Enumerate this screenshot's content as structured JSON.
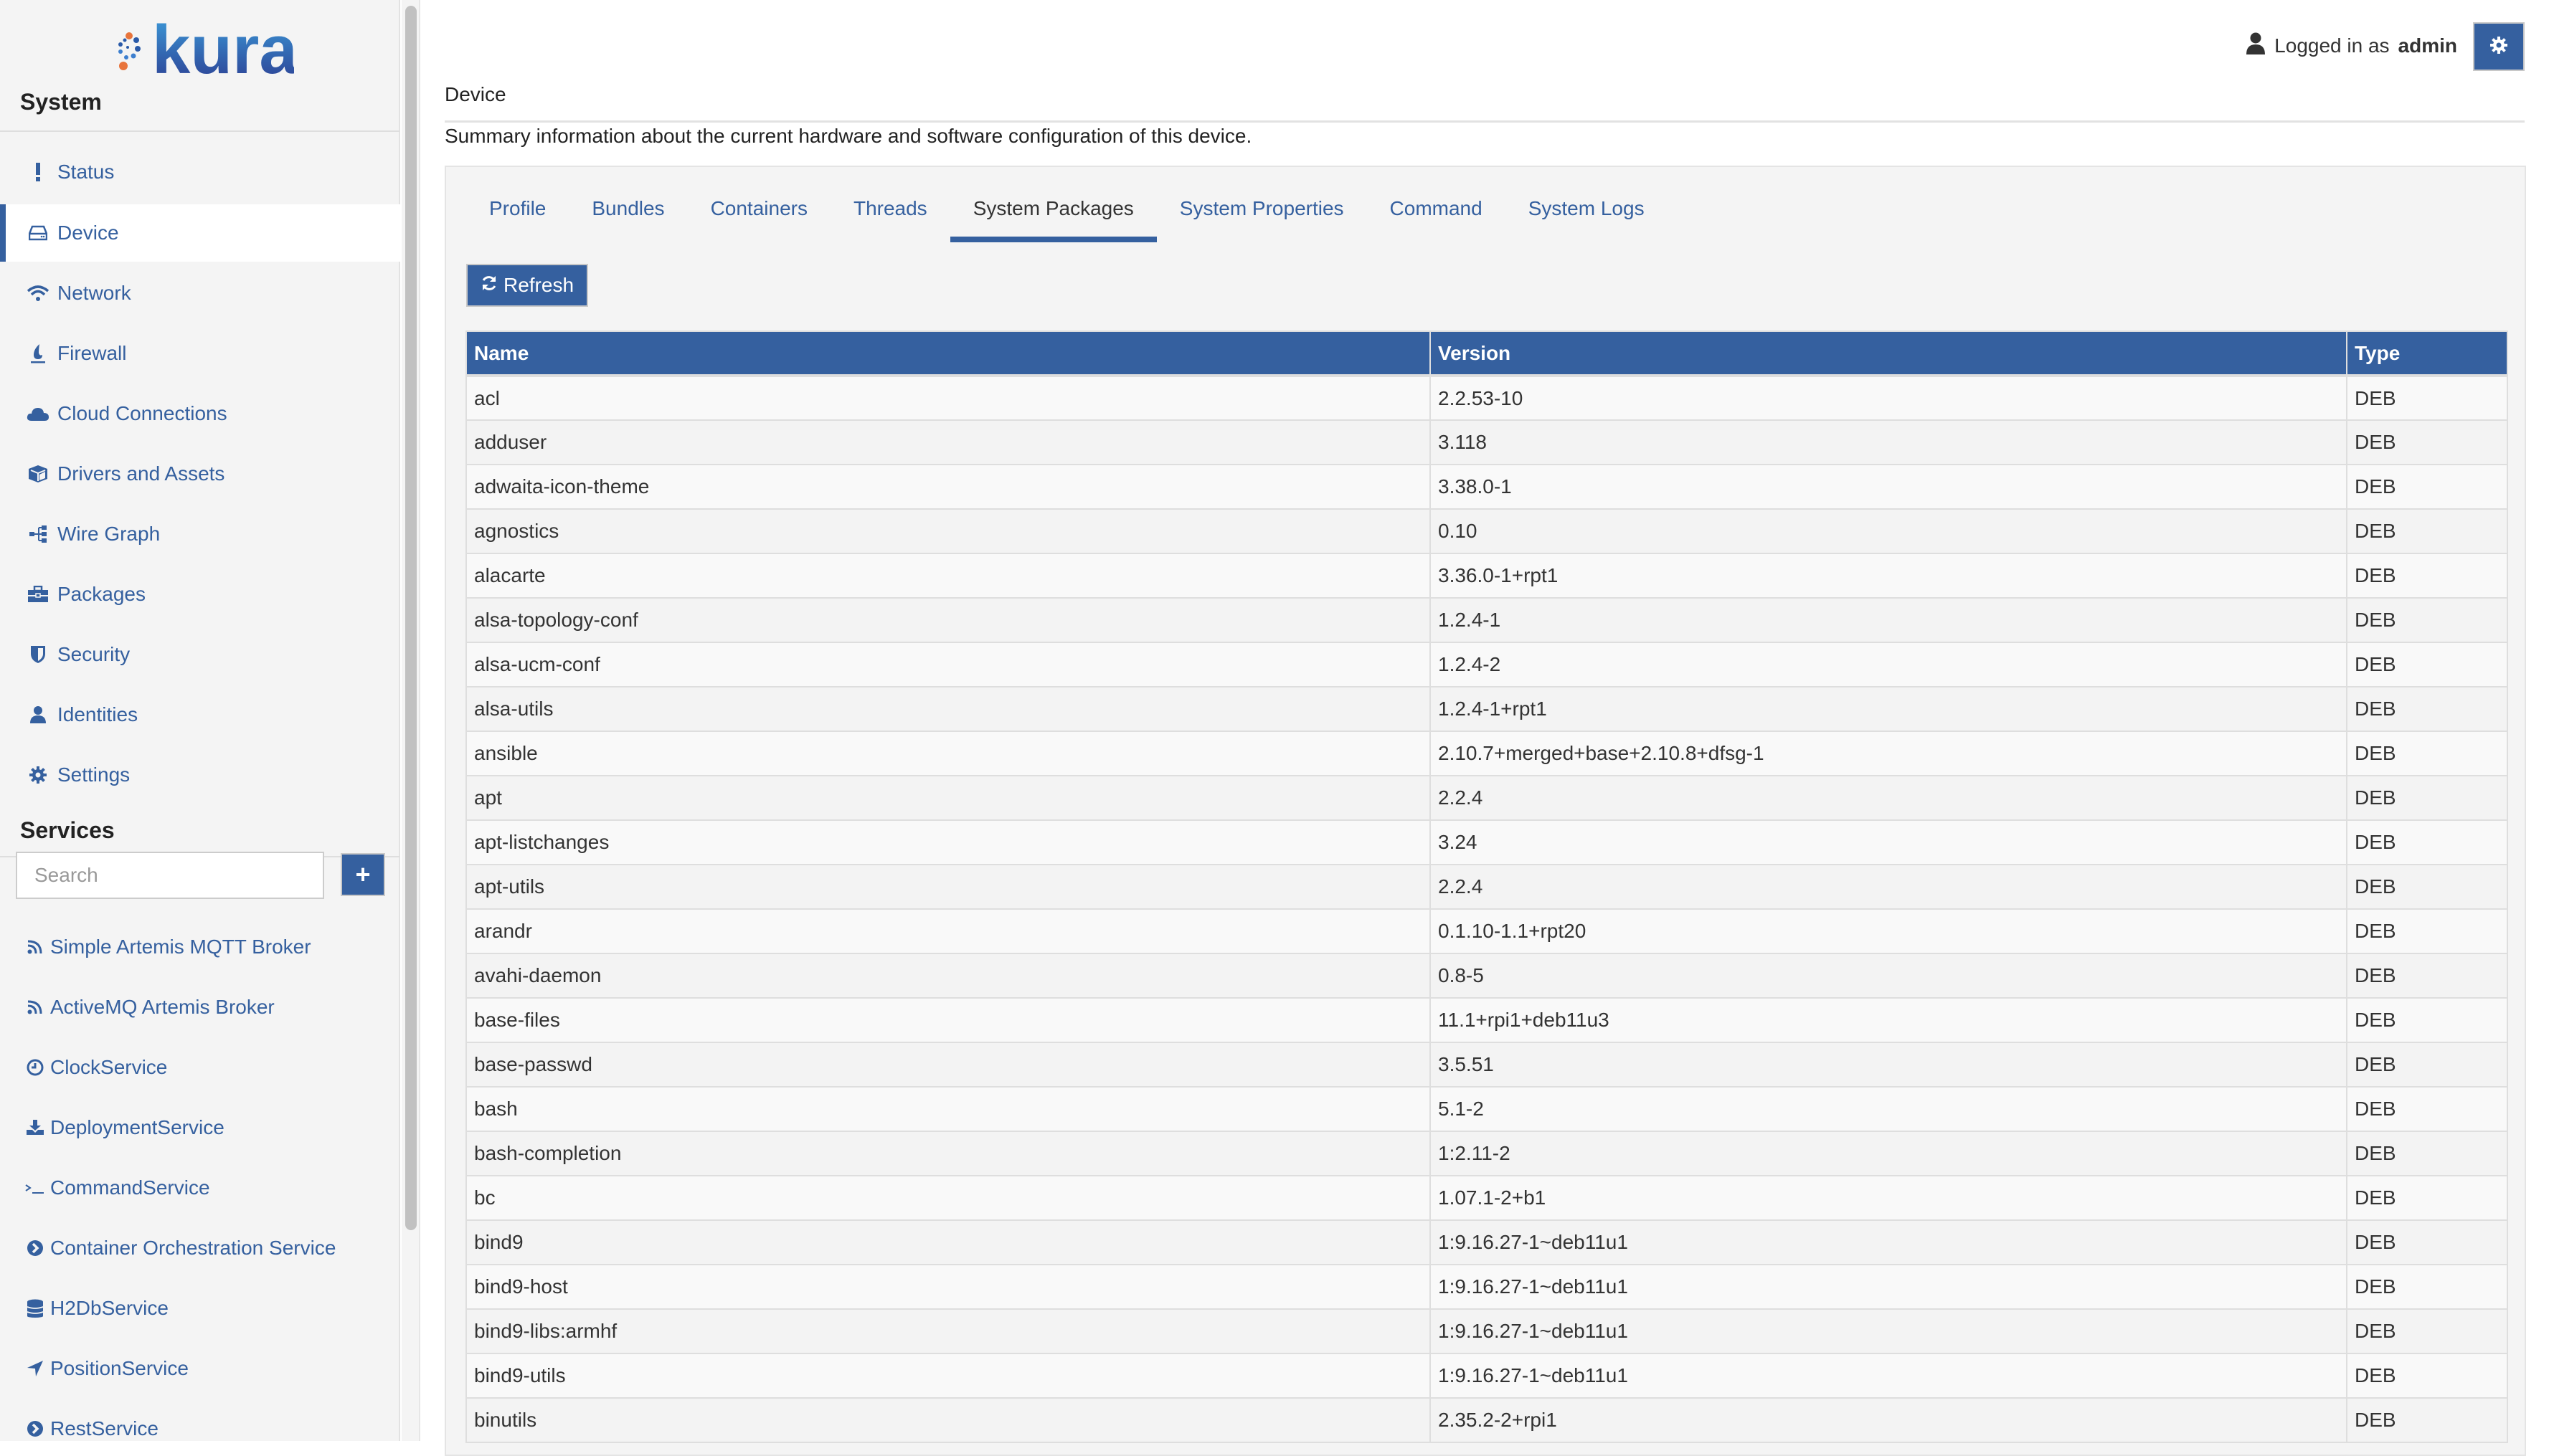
{
  "brand": {
    "name": "kura"
  },
  "sidebar": {
    "system_title": "System",
    "items": [
      {
        "label": "Status",
        "icon": "exclamation-icon"
      },
      {
        "label": "Device",
        "icon": "hdd-icon",
        "active": true
      },
      {
        "label": "Network",
        "icon": "wifi-icon"
      },
      {
        "label": "Firewall",
        "icon": "fire-icon"
      },
      {
        "label": "Cloud Connections",
        "icon": "cloud-icon"
      },
      {
        "label": "Drivers and Assets",
        "icon": "cube-icon"
      },
      {
        "label": "Wire Graph",
        "icon": "sitemap-icon"
      },
      {
        "label": "Packages",
        "icon": "briefcase-icon"
      },
      {
        "label": "Security",
        "icon": "shield-icon"
      },
      {
        "label": "Identities",
        "icon": "user-icon"
      },
      {
        "label": "Settings",
        "icon": "gear-icon"
      }
    ],
    "services_title": "Services",
    "search_placeholder": "Search",
    "add_label": "+",
    "services": [
      {
        "label": "Simple Artemis MQTT Broker",
        "icon": "rss-icon"
      },
      {
        "label": "ActiveMQ Artemis Broker",
        "icon": "rss-icon"
      },
      {
        "label": "ClockService",
        "icon": "clock-icon"
      },
      {
        "label": "DeploymentService",
        "icon": "download-icon"
      },
      {
        "label": "CommandService",
        "icon": "terminal-icon"
      },
      {
        "label": "Container Orchestration Service",
        "icon": "chevron-circle-right-icon"
      },
      {
        "label": "H2DbService",
        "icon": "database-icon"
      },
      {
        "label": "PositionService",
        "icon": "location-arrow-icon"
      },
      {
        "label": "RestService",
        "icon": "chevron-circle-right-icon"
      }
    ]
  },
  "header": {
    "logged_in_prefix": "Logged in as",
    "username": "admin"
  },
  "page": {
    "title": "Device",
    "summary": "Summary information about the current hardware and software configuration of this device.",
    "tabs": [
      {
        "label": "Profile"
      },
      {
        "label": "Bundles"
      },
      {
        "label": "Containers"
      },
      {
        "label": "Threads"
      },
      {
        "label": "System Packages",
        "active": true
      },
      {
        "label": "System Properties"
      },
      {
        "label": "Command"
      },
      {
        "label": "System Logs"
      }
    ],
    "refresh_label": "Refresh"
  },
  "table": {
    "columns": [
      "Name",
      "Version",
      "Type"
    ],
    "rows": [
      [
        "acl",
        "2.2.53-10",
        "DEB"
      ],
      [
        "adduser",
        "3.118",
        "DEB"
      ],
      [
        "adwaita-icon-theme",
        "3.38.0-1",
        "DEB"
      ],
      [
        "agnostics",
        "0.10",
        "DEB"
      ],
      [
        "alacarte",
        "3.36.0-1+rpt1",
        "DEB"
      ],
      [
        "alsa-topology-conf",
        "1.2.4-1",
        "DEB"
      ],
      [
        "alsa-ucm-conf",
        "1.2.4-2",
        "DEB"
      ],
      [
        "alsa-utils",
        "1.2.4-1+rpt1",
        "DEB"
      ],
      [
        "ansible",
        "2.10.7+merged+base+2.10.8+dfsg-1",
        "DEB"
      ],
      [
        "apt",
        "2.2.4",
        "DEB"
      ],
      [
        "apt-listchanges",
        "3.24",
        "DEB"
      ],
      [
        "apt-utils",
        "2.2.4",
        "DEB"
      ],
      [
        "arandr",
        "0.1.10-1.1+rpt20",
        "DEB"
      ],
      [
        "avahi-daemon",
        "0.8-5",
        "DEB"
      ],
      [
        "base-files",
        "11.1+rpi1+deb11u3",
        "DEB"
      ],
      [
        "base-passwd",
        "3.5.51",
        "DEB"
      ],
      [
        "bash",
        "5.1-2",
        "DEB"
      ],
      [
        "bash-completion",
        "1:2.11-2",
        "DEB"
      ],
      [
        "bc",
        "1.07.1-2+b1",
        "DEB"
      ],
      [
        "bind9",
        "1:9.16.27-1~deb11u1",
        "DEB"
      ],
      [
        "bind9-host",
        "1:9.16.27-1~deb11u1",
        "DEB"
      ],
      [
        "bind9-libs:armhf",
        "1:9.16.27-1~deb11u1",
        "DEB"
      ],
      [
        "bind9-utils",
        "1:9.16.27-1~deb11u1",
        "DEB"
      ],
      [
        "binutils",
        "2.35.2-2+rpi1",
        "DEB"
      ]
    ]
  },
  "colors": {
    "accent": "#35609f",
    "sidebar_bg": "#f4f4f4",
    "logo_orange": "#e8743b",
    "logo_blue": "#2a5aa8"
  }
}
